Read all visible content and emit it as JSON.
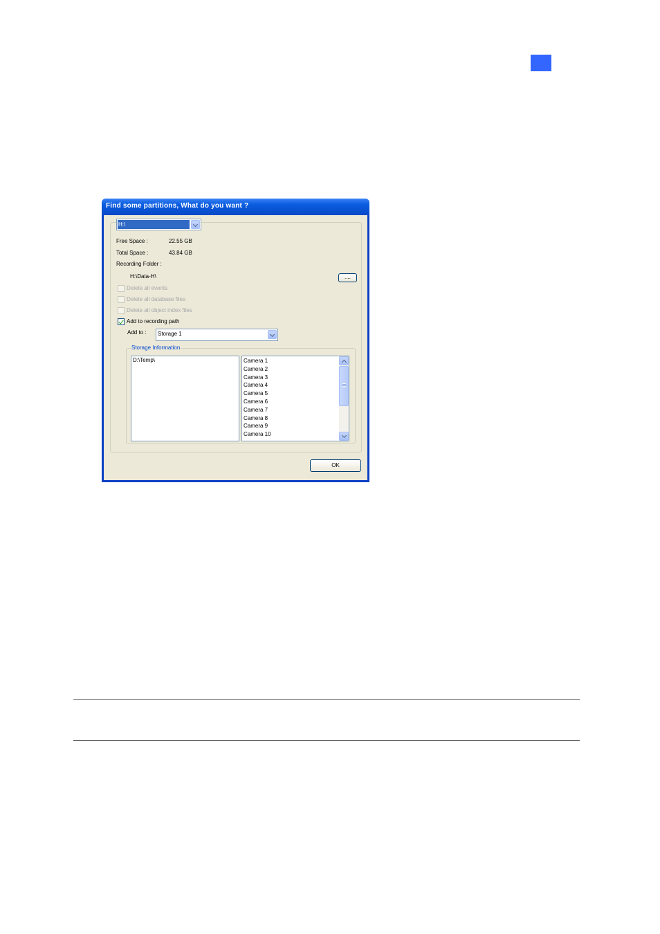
{
  "dialog": {
    "title": "Find some partitions, What do you want ?",
    "drive_combo": {
      "value": "H:\\"
    },
    "free_space": {
      "label": "Free Space :",
      "value": "22.55 GB"
    },
    "total_space": {
      "label": "Total Space :",
      "value": "43.84 GB"
    },
    "recording_folder": {
      "label": "Recording Folder :",
      "value": "H:\\Data-H\\"
    },
    "browse_button": "....",
    "options": [
      {
        "label": "Delete all events",
        "checked": false,
        "enabled": false
      },
      {
        "label": "Delete all database files",
        "checked": false,
        "enabled": false
      },
      {
        "label": "Delete all object index files",
        "checked": false,
        "enabled": false
      },
      {
        "label": "Add to recording path",
        "checked": true,
        "enabled": true
      }
    ],
    "add_to": {
      "label": "Add to :",
      "value": "Storage 1"
    },
    "storage_information": {
      "legend": "Storage Information",
      "paths": [
        "D:\\Temp\\"
      ],
      "cameras": [
        "Camera 1",
        "Camera 2",
        "Camera 3",
        "Camera 4",
        "Camera 5",
        "Camera 6",
        "Camera 7",
        "Camera 8",
        "Camera 9",
        "Camera 10"
      ]
    },
    "ok_button": "OK"
  },
  "colors": {
    "page_marker": "#3366ff",
    "title_bar": "#0b5de0",
    "dialog_face": "#ece9d8"
  }
}
